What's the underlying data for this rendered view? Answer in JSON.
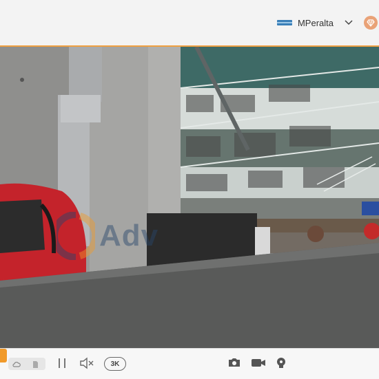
{
  "header": {
    "username": "MPeralta"
  },
  "watermark": {
    "text": "Adv"
  },
  "controls": {
    "quality_label": "3K"
  },
  "icons": {
    "flag": "flag-icon",
    "chevron": "chevron-down-icon",
    "avatar": "diamond-avatar-icon",
    "pause": "pause-icon",
    "mute": "speaker-muted-icon",
    "camera": "camera-icon",
    "video": "video-camera-icon",
    "spotlight": "light-bulb-icon"
  },
  "colors": {
    "accent": "#f19a2a",
    "topbar": "#f3f3f3",
    "avatar": "#e9a277"
  }
}
